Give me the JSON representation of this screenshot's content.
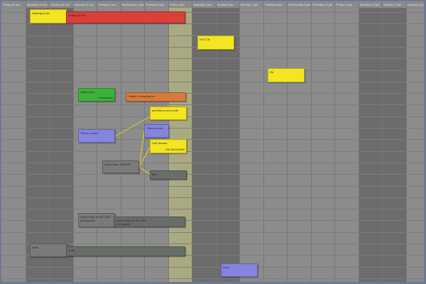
{
  "days": [
    "Friday 28 dec.",
    "Saturday 29 dec.",
    "Sunday 30 dec.",
    "Monday 31 dec.",
    "Tuesday 1 jan.",
    "Wednesday 2 jan.",
    "Thursday 3 jan.",
    "Friday 4 jan.",
    "Saturday 5 jan.",
    "Sunday 6 jan.",
    "Monday 7 jan.",
    "Tuesday 8 jan.",
    "Wednesday 9 jan.",
    "Thursday 10 jan.",
    "Friday 11 jan.",
    "Saturday 12 jan.",
    "Sunday 13 jan.",
    "Monday 14 jan."
  ],
  "notes": {
    "nothing_todo_a": "Nothing to do!",
    "nothing_todo_b": "Nothing to do!",
    "nothing_todo_b_mark": "!",
    "not_ok": "NOT Ok",
    "ok": "Ok",
    "urgent": "Urgent job!",
    "urgent_sub": "mhdwwqrm",
    "closed": "Closed, everything ok",
    "not_a_note": "and this is not a note",
    "a_note": "This is a note!",
    "this_a_note": "This is a note",
    "call": "Call Vincent",
    "phone": "+39 101010999",
    "toner_top": "Order toner 278a HP",
    "item": "Item",
    "toner1100_a": "Order toner for HP 1100\n(not urgent)",
    "toner1100_b": "Order toner for HP 1100\n(not urgent)",
    "order_a": "order",
    "order_b": "order",
    "order_b_mark": "!",
    "nerd": "Nerd"
  },
  "colors": {
    "yellow": "#f2e522",
    "red": "#d9403a",
    "green": "#3db23a",
    "orange": "#d77a3c",
    "blue": "#8585e0",
    "gray_dark": "#6a6e69",
    "gray_mid": "#7a7a7a",
    "today": "#aaaa82",
    "weekend": "#6c6c6c",
    "link": "#e8d420"
  }
}
